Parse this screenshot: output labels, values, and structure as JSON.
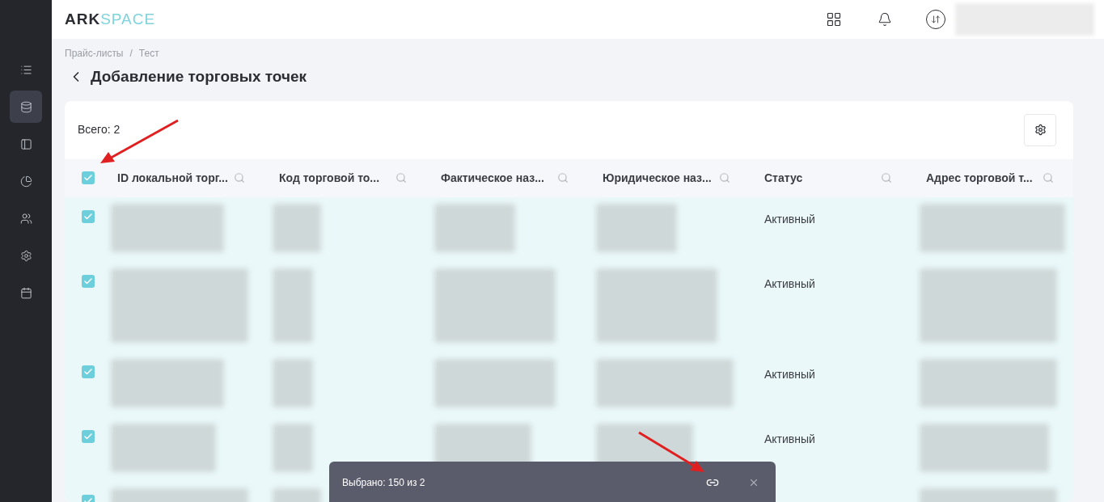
{
  "logo": {
    "part_1": "ARK",
    "part_2": "SPACE"
  },
  "sidebar": {
    "items": [
      {
        "selected": false
      },
      {
        "selected": true
      },
      {
        "selected": false
      },
      {
        "selected": false
      },
      {
        "selected": false
      },
      {
        "selected": false
      },
      {
        "selected": false
      }
    ]
  },
  "breadcrumb": {
    "items": [
      "Прайс-листы",
      "Тест"
    ],
    "separator": "/"
  },
  "page_title": "Добавление торговых точек",
  "total": "Всего: 2",
  "table": {
    "all_checked": true,
    "columns": [
      "ID локальной торг...",
      "Код торговой то...",
      "Фактическое наз...",
      "Юридическое наз...",
      "Статус",
      "Адрес торговой т..."
    ],
    "rows": [
      {
        "selected": true,
        "status": "Активный"
      },
      {
        "selected": true,
        "status": "Активный"
      },
      {
        "selected": true,
        "status": "Активный"
      },
      {
        "selected": true,
        "status": "Активный"
      },
      {
        "selected": true
      }
    ]
  },
  "selection_bar": {
    "text": "Выбрано: 150 из 2"
  }
}
